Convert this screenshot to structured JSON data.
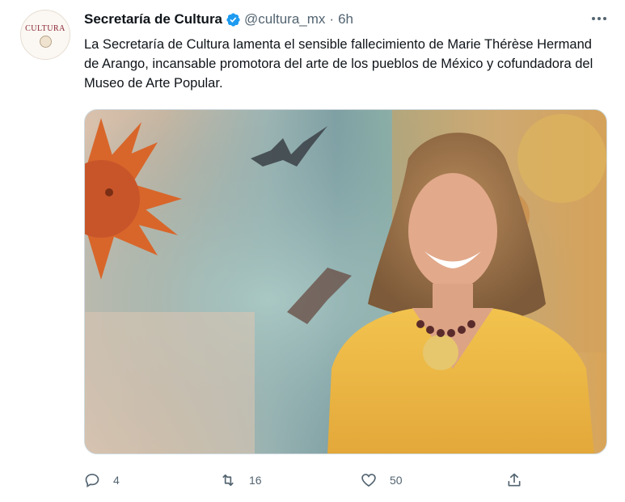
{
  "tweet": {
    "avatar": {
      "text": "CULTURA"
    },
    "author": {
      "display_name": "Secretaría de Cultura",
      "handle": "@cultura_mx",
      "separator": "·",
      "time": "6h",
      "verified": true
    },
    "more_label": "···",
    "text": "La Secretaría de Cultura lamenta el sensible fallecimiento de Marie Thérèse Hermand de Arango, incansable promotora del arte de los pueblos de México y cofundadora del Museo de Arte Popular.",
    "actions": {
      "reply": {
        "icon": "reply-icon",
        "count": "4"
      },
      "retweet": {
        "icon": "retweet-icon",
        "count": "16"
      },
      "like": {
        "icon": "like-icon",
        "count": "50"
      },
      "share": {
        "icon": "share-icon"
      }
    },
    "colors": {
      "text": "#0f1419",
      "secondary": "#536471",
      "verified": "#1d9bf0",
      "border": "#cfd9de"
    }
  }
}
